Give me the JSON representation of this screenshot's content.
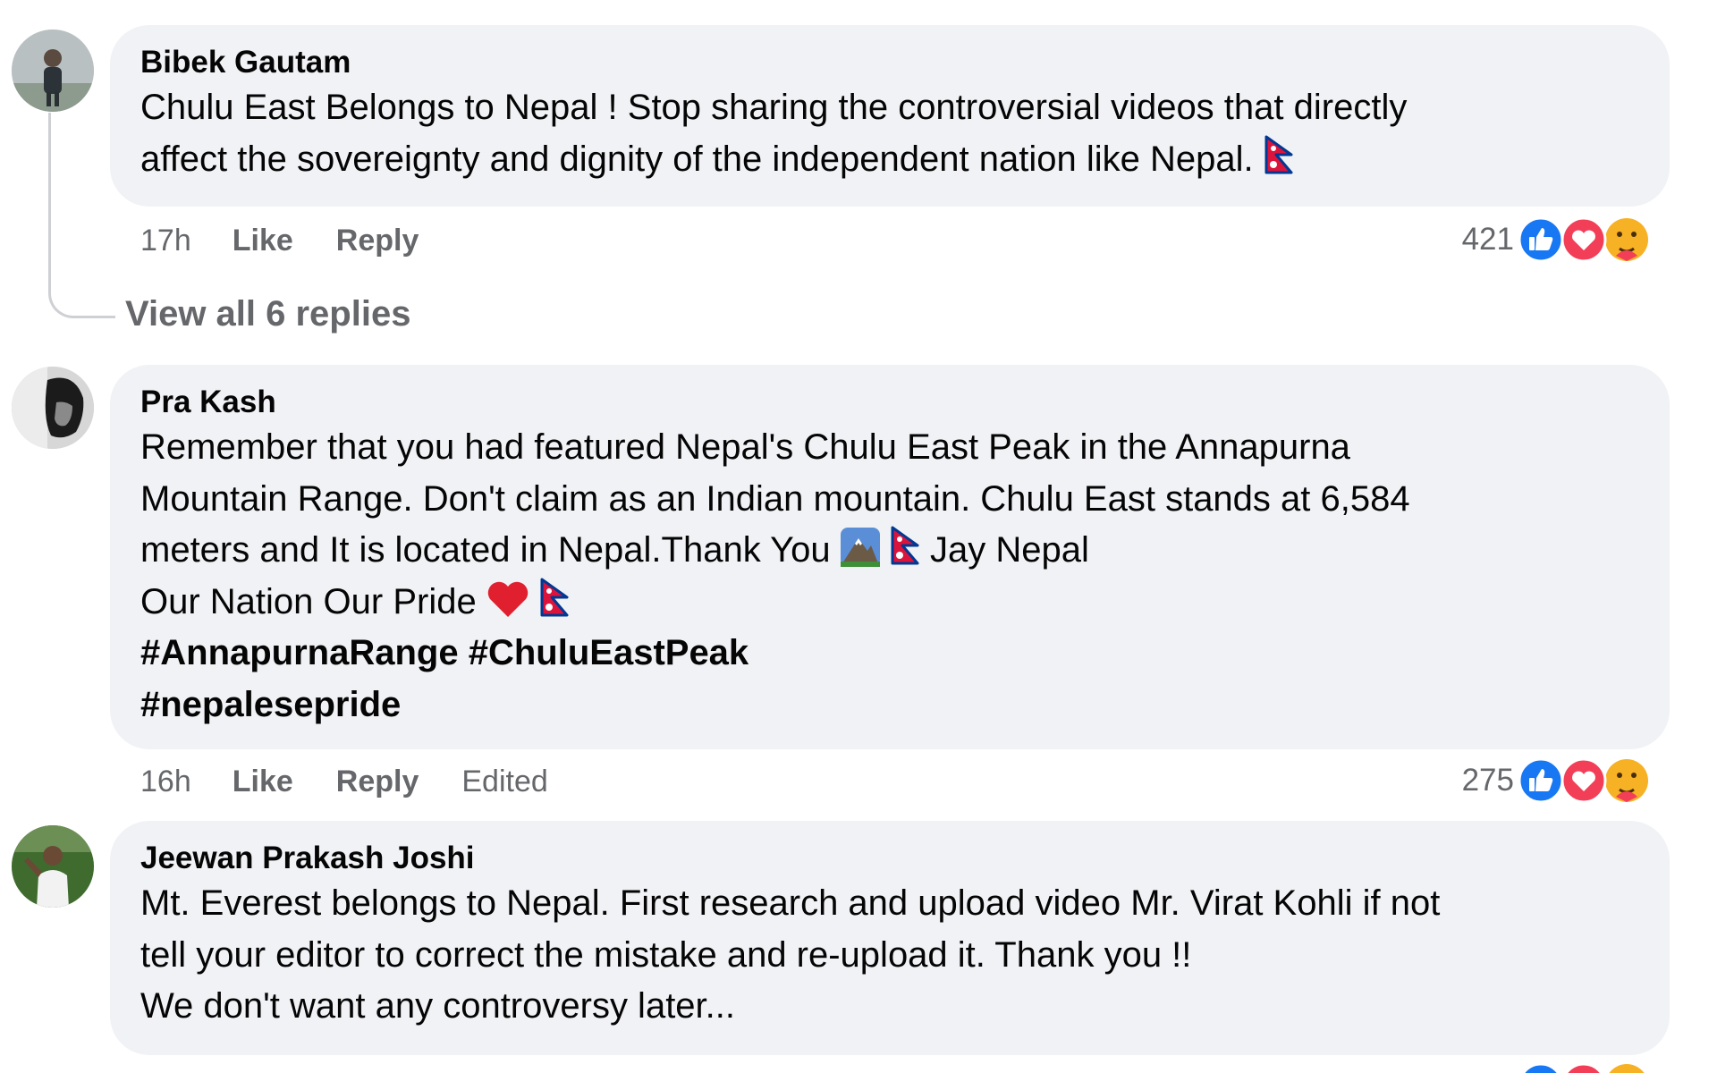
{
  "comments": [
    {
      "author": "Bibek Gautam",
      "lines": [
        "Chulu East Belongs to Nepal ! Stop sharing the controversial videos that directly",
        "affect the sovereignty and dignity of the independent nation like Nepal."
      ],
      "time": "17h",
      "like_label": "Like",
      "reply_label": "Reply",
      "reaction_count": "421",
      "view_replies": "View all 6 replies"
    },
    {
      "author": "Pra Kash",
      "lines": [
        "Remember that you had featured Nepal's Chulu East Peak in the Annapurna",
        "Mountain Range. Don't claim as an Indian mountain. Chulu East stands at 6,584",
        "meters and It is located in Nepal.Thank You",
        "Jay Nepal",
        "Our Nation Our Pride"
      ],
      "hashtags": [
        "#AnnapurnaRange #ChuluEastPeak",
        "#nepalesepride"
      ],
      "time": "16h",
      "like_label": "Like",
      "reply_label": "Reply",
      "edited_label": "Edited",
      "reaction_count": "275"
    },
    {
      "author": "Jeewan Prakash Joshi",
      "lines": [
        "Mt. Everest belongs to Nepal. First research and upload video Mr. Virat Kohli if not",
        "tell your editor to correct the mistake and re-upload it. Thank you !!",
        "We don't want any controversy later..."
      ]
    }
  ],
  "reaction_types": [
    "like-icon",
    "love-icon",
    "care-icon"
  ],
  "colors": {
    "bubble_bg": "#f0f2f5",
    "meta_text": "#65676b",
    "like_blue": "#1877f2",
    "love_red": "#f33e58",
    "care_yellow": "#f7b125"
  }
}
